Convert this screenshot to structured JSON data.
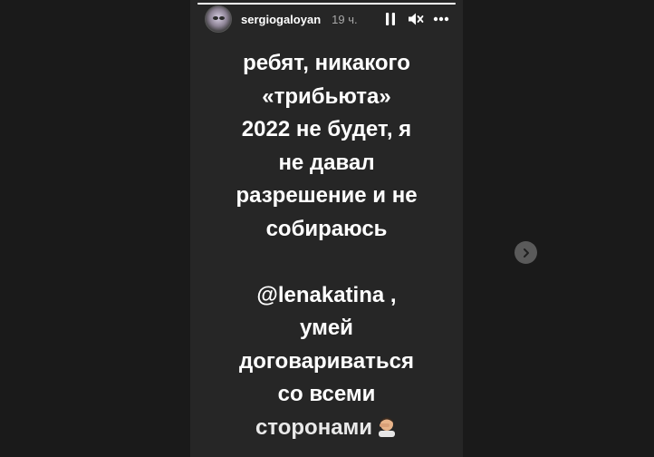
{
  "header": {
    "username": "sergiogaloyan",
    "timestamp": "19 ч."
  },
  "progress": {
    "fraction": 1.0
  },
  "icons": {
    "pause": "pause-icon",
    "mute": "volume-muted-icon",
    "more": "more-options-icon",
    "next": "chevron-right-icon",
    "emoji": "man-facepalming-emoji"
  },
  "story": {
    "line1": "ребят, никакого",
    "line2": "«трибьюта»",
    "line3": "2022 не будет, я",
    "line4": "не давал",
    "line5": "разрешение и не",
    "line6": "собираюсь",
    "mention": "@lenakatina",
    "mention_suffix": " ,",
    "line8": "умей",
    "line9": "договариваться",
    "line10": "со всеми",
    "line11": "сторонами"
  },
  "colors": {
    "background": "#1a1a1a",
    "card": "#262626",
    "text": "#ffffff",
    "muted": "#a8a8a8"
  }
}
